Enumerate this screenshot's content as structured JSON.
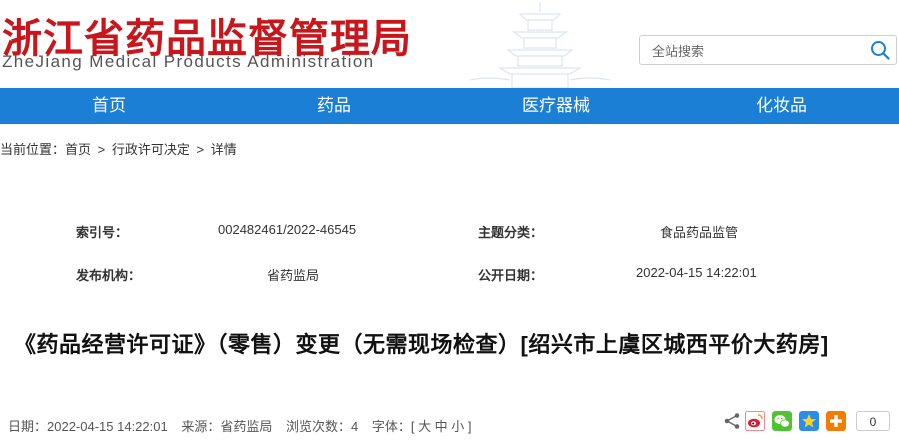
{
  "header": {
    "logo_cn": "浙江省药品监督管理局",
    "logo_en": "ZheJiang Medical Products Administration",
    "search_placeholder": "全站搜索"
  },
  "nav": {
    "items": [
      {
        "label": "首页"
      },
      {
        "label": "药品"
      },
      {
        "label": "医疗器械"
      },
      {
        "label": "化妆品"
      }
    ]
  },
  "breadcrumb": {
    "prefix": "当前位置：",
    "items": [
      "首页",
      ">",
      "行政许可决定",
      ">",
      "详情"
    ]
  },
  "meta": {
    "index_label": "索引号：",
    "index_value": "002482461/2022-46545",
    "topic_label": "主题分类：",
    "topic_value": "食品药品监管",
    "publisher_label": "发布机构：",
    "publisher_value": "省药监局",
    "date_label": "公开日期：",
    "date_value": "2022-04-15 14:22:01"
  },
  "article": {
    "title": "《药品经营许可证》（零售）变更（无需现场检查）[绍兴市上虞区城西平价大药房]",
    "date": "日期：2022-04-15 14:22:01",
    "source": "来源：省药监局",
    "views": "浏览次数：4",
    "font_size": "字体：[ 大 中 小 ]"
  },
  "share": {
    "icons": [
      "share-icon",
      "weibo-icon",
      "wechat-icon",
      "qzone-icon",
      "more-share-icon"
    ],
    "count": "0"
  },
  "colors": {
    "brand_red": "#c8161d",
    "nav_blue": "#1c7fd6"
  }
}
